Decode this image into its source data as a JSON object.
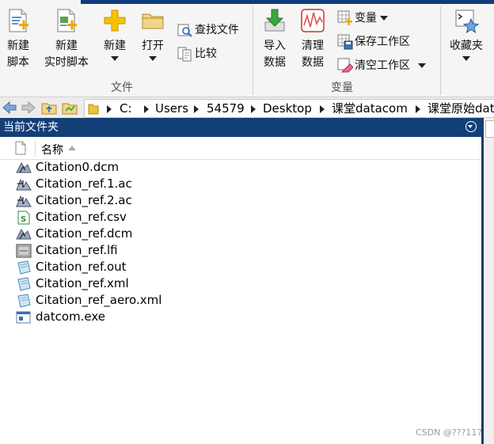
{
  "ribbon": {
    "group_file": "文件",
    "group_variable": "变量",
    "new_script": "新建\n脚本",
    "new_script_line1": "新建",
    "new_script_line2": "脚本",
    "new_live_line1": "新建",
    "new_live_line2": "实时脚本",
    "new_label": "新建",
    "open_label": "打开",
    "find_files": "查找文件",
    "compare": "比较",
    "import_line1": "导入",
    "import_line2": "数据",
    "clean_line1": "清理",
    "clean_line2": "数据",
    "variable": "变量",
    "save_workspace": "保存工作区",
    "clear_workspace": "清空工作区",
    "favorites": "收藏夹"
  },
  "address": {
    "crumbs": [
      "C:",
      "Users",
      "54579",
      "Desktop",
      "课堂datacom",
      "课堂原始dat"
    ]
  },
  "panel": {
    "title": "当前文件夹",
    "column_name": "名称"
  },
  "files": [
    {
      "name": "Citation0.dcm",
      "icon": "dcm-icon"
    },
    {
      "name": "Citation_ref.1.ac",
      "icon": "ac-icon"
    },
    {
      "name": "Citation_ref.2.ac",
      "icon": "ac-icon"
    },
    {
      "name": "Citation_ref.csv",
      "icon": "csv-icon"
    },
    {
      "name": "Citation_ref.dcm",
      "icon": "dcm-icon"
    },
    {
      "name": "Citation_ref.lfi",
      "icon": "lfi-icon"
    },
    {
      "name": "Citation_ref.out",
      "icon": "generic-file-icon"
    },
    {
      "name": "Citation_ref.xml",
      "icon": "generic-file-icon"
    },
    {
      "name": "Citation_ref_aero.xml",
      "icon": "generic-file-icon"
    },
    {
      "name": "datcom.exe",
      "icon": "exe-icon"
    }
  ],
  "watermark": "CSDN @???117",
  "colors": {
    "panel_title_bg": "#133f77",
    "top_accent": "#0e3d7a"
  }
}
